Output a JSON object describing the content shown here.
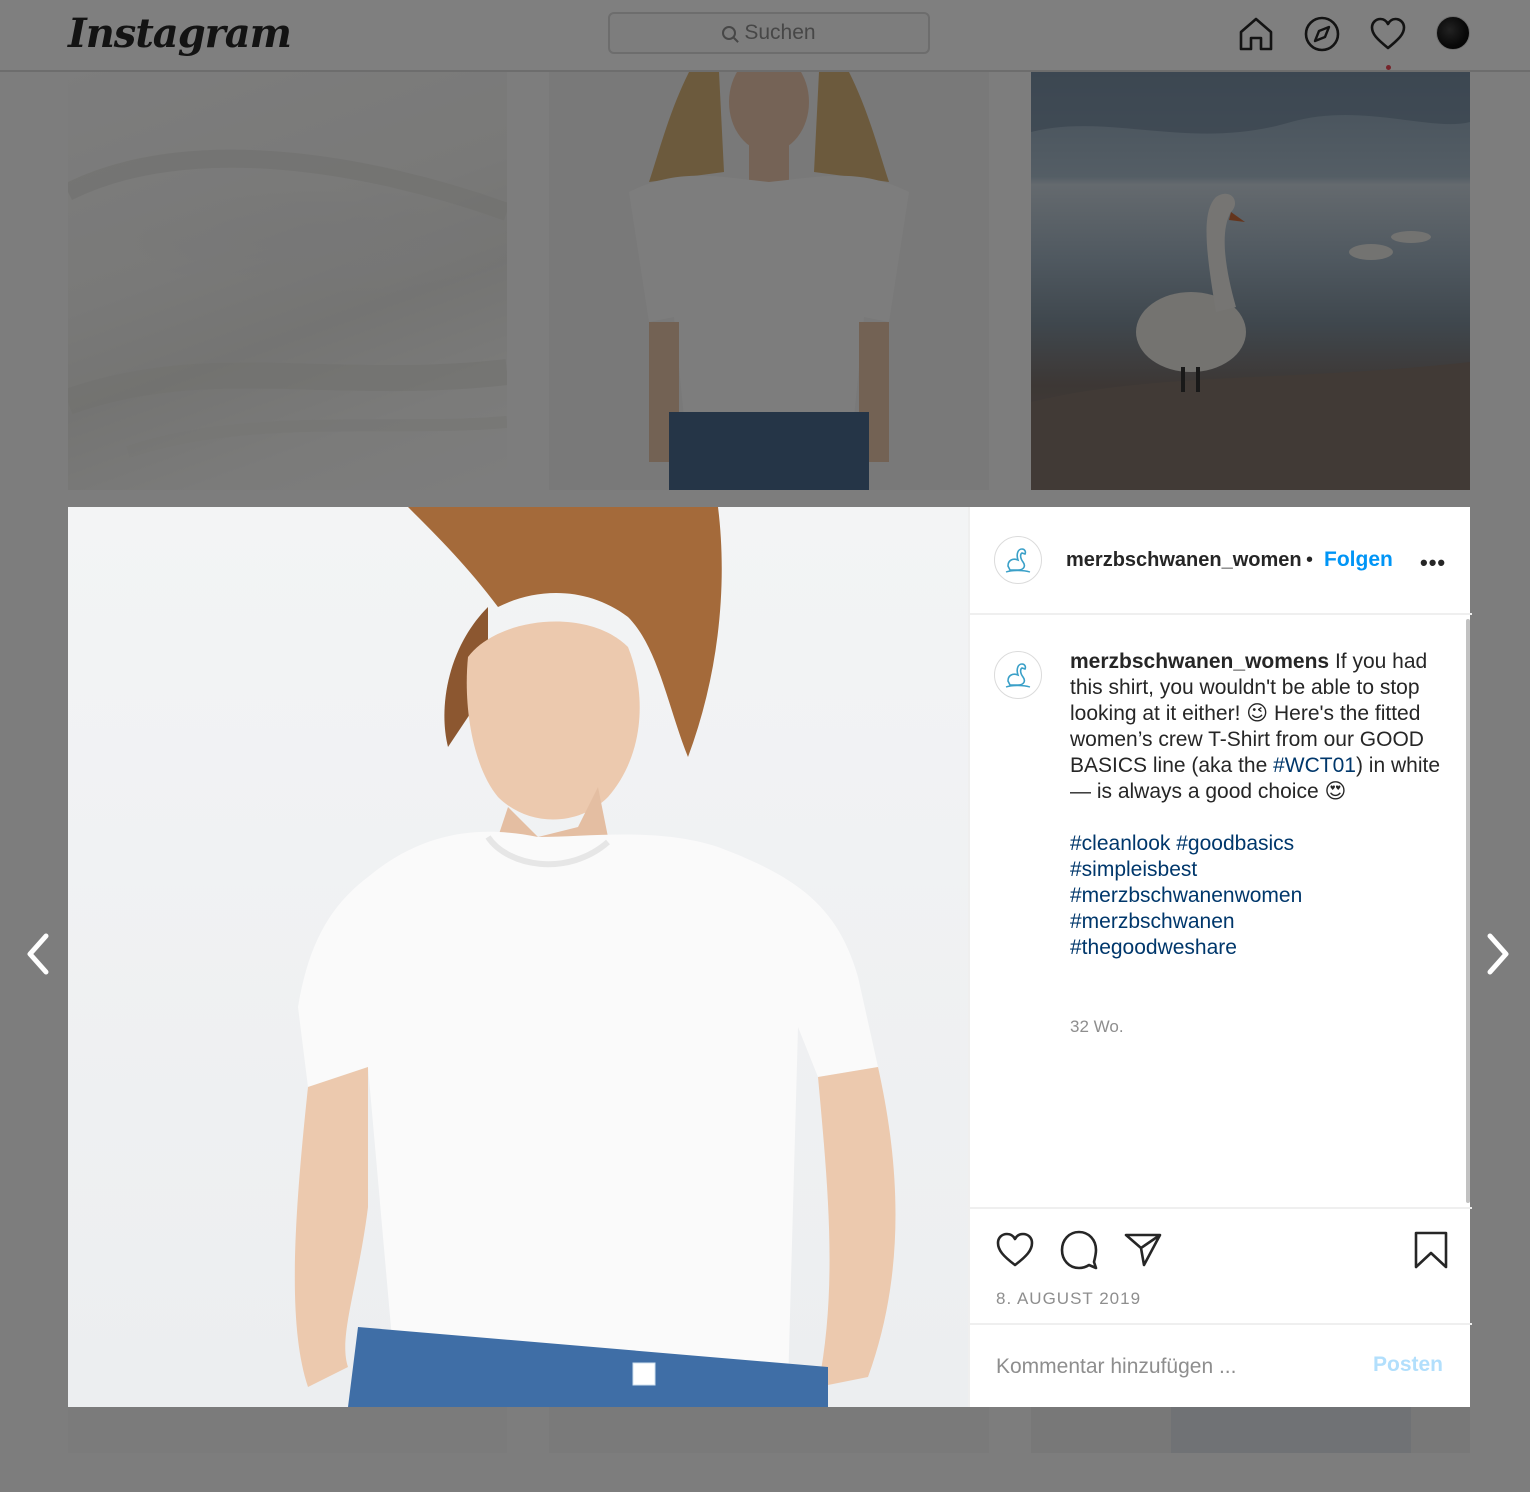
{
  "header": {
    "logo": "Instagram",
    "search_placeholder": "Suchen"
  },
  "nav_icons": [
    "home-icon",
    "explore-icon",
    "heart-icon",
    "profile-avatar"
  ],
  "colors": {
    "accent": "#0095f6",
    "hashtag": "#00376b",
    "muted": "#8e8e8e",
    "notification": "#ed4956",
    "post_disabled": "#b2dffc"
  },
  "post": {
    "username_header": "merzbschwanen_womens",
    "separator": "•",
    "follow_label": "Folgen",
    "more_label": "•••",
    "caption": {
      "username": "merzbschwanen_womens",
      "text_before_tag": "If you had this shirt, you wouldn't be able to stop looking at it either! 😉 Here's the fitted women’s crew T-Shirt from our GOOD BASICS line (aka the",
      "inline_tag": "#WCT01",
      "text_after_tag": ") in white — is always a good choice 😍",
      "hashtags": [
        "#cleanlook",
        "#goodbasics",
        "#simpleisbest",
        "#merzbschwanenwomen",
        "#merzbschwanen",
        "#thegoodweshare"
      ],
      "time": "32 Wo."
    },
    "actions": [
      "like-icon",
      "comment-icon",
      "share-icon",
      "save-icon"
    ],
    "date": "8. AUGUST 2019",
    "comment_placeholder": "Kommentar hinzufügen ...",
    "post_label": "Posten"
  }
}
